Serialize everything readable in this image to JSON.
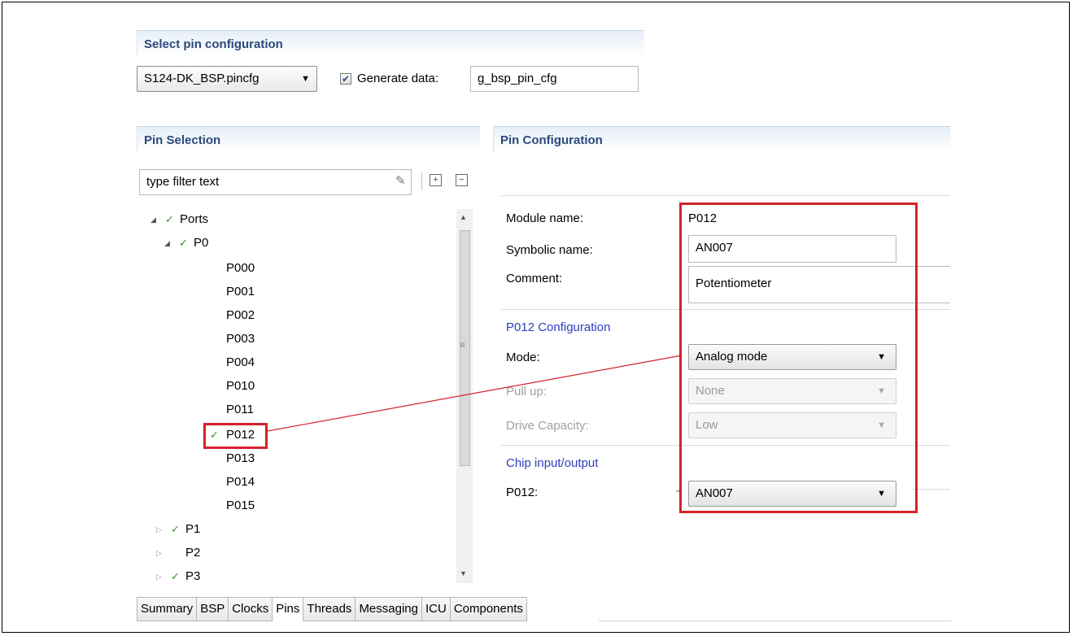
{
  "select_section": {
    "title": "Select pin configuration",
    "config_value": "S124-DK_BSP.pincfg",
    "generate_label": "Generate data:",
    "generate_checked": true,
    "generate_value": "g_bsp_pin_cfg"
  },
  "pin_selection": {
    "title": "Pin Selection",
    "filter_placeholder": "type filter text",
    "tree": [
      {
        "label": "Ports",
        "expanded": true,
        "checked": true
      },
      {
        "label": "P0",
        "expanded": true,
        "checked": true
      },
      {
        "label": "P000"
      },
      {
        "label": "P001"
      },
      {
        "label": "P002"
      },
      {
        "label": "P003"
      },
      {
        "label": "P004"
      },
      {
        "label": "P010"
      },
      {
        "label": "P011"
      },
      {
        "label": "P012",
        "checked": true,
        "selected": true
      },
      {
        "label": "P013"
      },
      {
        "label": "P014"
      },
      {
        "label": "P015"
      },
      {
        "label": "P1",
        "expanded": false,
        "checked": true
      },
      {
        "label": "P2",
        "expanded": false,
        "checked": false
      },
      {
        "label": "P3",
        "expanded": false,
        "checked": true
      }
    ]
  },
  "pin_configuration": {
    "title": "Pin Configuration",
    "module_name_label": "Module name:",
    "module_name_value": "P012",
    "symbolic_name_label": "Symbolic name:",
    "symbolic_name_value": "AN007",
    "comment_label": "Comment:",
    "comment_value": "Potentiometer",
    "config_heading": "P012 Configuration",
    "mode_label": "Mode:",
    "mode_value": "Analog mode",
    "pullup_label": "Pull up:",
    "pullup_value": "None",
    "drive_label": "Drive Capacity:",
    "drive_value": "Low",
    "chip_io_heading": "Chip input/output",
    "pin_label": "P012:",
    "pin_value": "AN007"
  },
  "tabs": [
    "Summary",
    "BSP",
    "Clocks",
    "Pins",
    "Threads",
    "Messaging",
    "ICU",
    "Components"
  ],
  "active_tab": "Pins",
  "colors": {
    "highlight": "#d2232a",
    "heading_blue": "#2b4a7a",
    "link_blue": "#2b3ec2",
    "check_green": "#3b8d2e"
  },
  "icons": {
    "clear_filter": "eraser-icon",
    "expand_all": "expand-all-icon",
    "collapse_all": "collapse-all-icon"
  }
}
